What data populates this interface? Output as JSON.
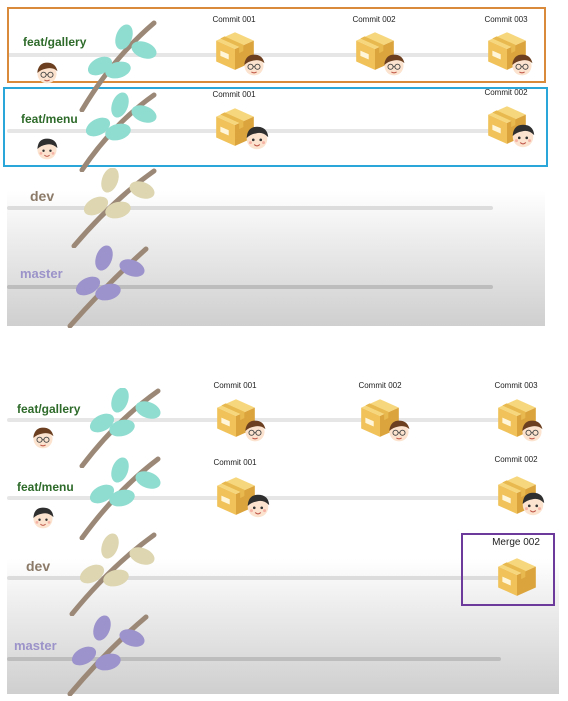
{
  "colors": {
    "orange_frame": "#d98a3a",
    "blue_frame": "#2ba6d8",
    "purple_frame": "#6c3a9a",
    "feat_label": "#2e6b2a",
    "dev_label": "#8b7a68",
    "master_label": "#9b93c9",
    "feat_leaf": "#8fdcd0",
    "dev_leaf": "#ddd6b0",
    "master_leaf": "#9c92cc",
    "stem": "#9c8876",
    "box": "#f0c259"
  },
  "icons": {
    "branch_sprig": "leaf-sprig-icon",
    "commit_box": "package-box-icon",
    "developer": "developer-avatar-icon"
  },
  "top": {
    "branches": {
      "gallery": "feat/gallery",
      "menu": "feat/menu",
      "dev": "dev",
      "master": "master"
    },
    "gallery_commits": [
      "Commit 001",
      "Commit 002",
      "Commit 003"
    ],
    "menu_commits": [
      "Commit 001",
      "Commit 002"
    ]
  },
  "bottom": {
    "branches": {
      "gallery": "feat/gallery",
      "menu": "feat/menu",
      "dev": "dev",
      "master": "master"
    },
    "gallery_commits": [
      "Commit 001",
      "Commit 002",
      "Commit 003"
    ],
    "menu_commits": [
      "Commit 001",
      "Commit 002"
    ],
    "merge_label": "Merge 002"
  }
}
